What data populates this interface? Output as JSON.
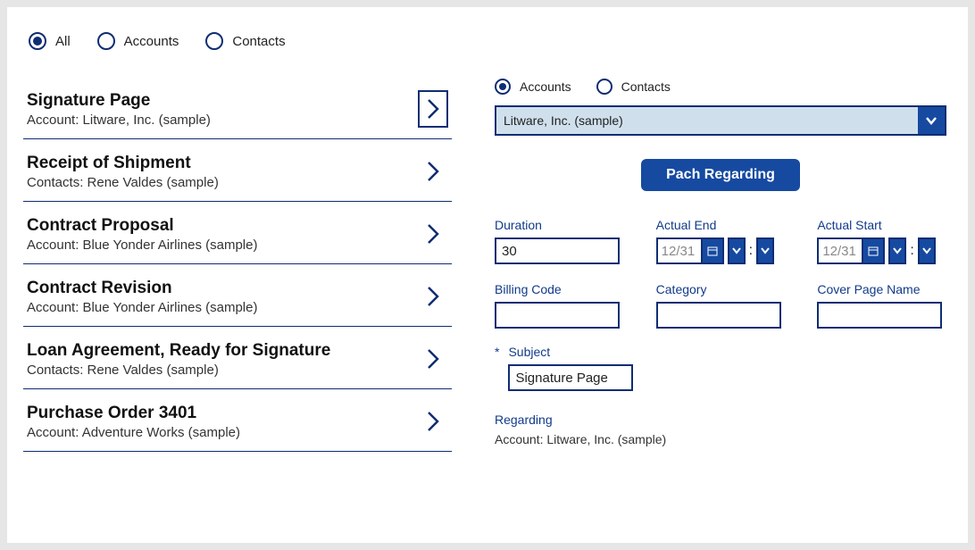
{
  "topFilter": {
    "options": [
      {
        "label": "All",
        "selected": true
      },
      {
        "label": "Accounts",
        "selected": false
      },
      {
        "label": "Contacts",
        "selected": false
      }
    ]
  },
  "list": {
    "items": [
      {
        "title": "Signature Page",
        "sub": "Account: Litware, Inc. (sample)",
        "selected": true
      },
      {
        "title": "Receipt of Shipment",
        "sub": "Contacts: Rene Valdes (sample)",
        "selected": false
      },
      {
        "title": "Contract Proposal",
        "sub": "Account: Blue Yonder Airlines (sample)",
        "selected": false
      },
      {
        "title": "Contract Revision",
        "sub": "Account: Blue Yonder Airlines (sample)",
        "selected": false
      },
      {
        "title": "Loan Agreement, Ready for Signature",
        "sub": "Contacts: Rene Valdes (sample)",
        "selected": false
      },
      {
        "title": "Purchase Order 3401",
        "sub": "Account: Adventure Works (sample)",
        "selected": false
      }
    ]
  },
  "detail": {
    "typeFilter": {
      "options": [
        {
          "label": "Accounts",
          "selected": true
        },
        {
          "label": "Contacts",
          "selected": false
        }
      ]
    },
    "entityDropdown": {
      "value": "Litware, Inc. (sample)"
    },
    "primaryButton": "Pach Regarding",
    "fields": {
      "duration": {
        "label": "Duration",
        "value": "30"
      },
      "actualEnd": {
        "label": "Actual End",
        "placeholder": "12/31"
      },
      "actualStart": {
        "label": "Actual Start",
        "placeholder": "12/31"
      },
      "billingCode": {
        "label": "Billing Code",
        "value": ""
      },
      "category": {
        "label": "Category",
        "value": ""
      },
      "coverPageName": {
        "label": "Cover Page Name",
        "value": ""
      }
    },
    "subject": {
      "label": "Subject",
      "value": "Signature Page",
      "required": true
    },
    "regarding": {
      "label": "Regarding",
      "value": "Account: Litware, Inc. (sample)"
    }
  }
}
